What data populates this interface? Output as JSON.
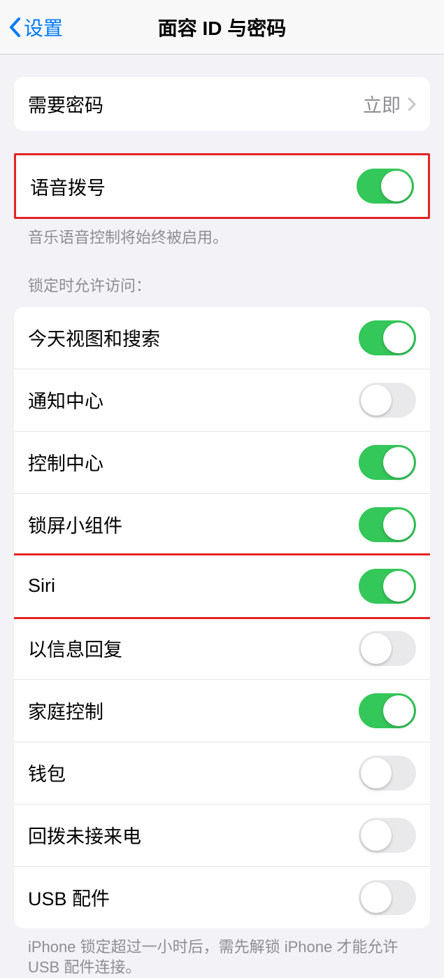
{
  "header": {
    "back_label": "设置",
    "title": "面容 ID 与密码"
  },
  "passcode_section": {
    "require_passcode_label": "需要密码",
    "require_passcode_value": "立即"
  },
  "voice_dial": {
    "label": "语音拨号",
    "on": true,
    "footer": "音乐语音控制将始终被启用。"
  },
  "lock_section": {
    "header": "锁定时允许访问：",
    "items": [
      {
        "label": "今天视图和搜索",
        "on": true,
        "highlighted": false
      },
      {
        "label": "通知中心",
        "on": false,
        "highlighted": false
      },
      {
        "label": "控制中心",
        "on": true,
        "highlighted": false
      },
      {
        "label": "锁屏小组件",
        "on": true,
        "highlighted": false
      },
      {
        "label": "Siri",
        "on": true,
        "highlighted": true
      },
      {
        "label": "以信息回复",
        "on": false,
        "highlighted": false
      },
      {
        "label": "家庭控制",
        "on": true,
        "highlighted": false
      },
      {
        "label": "钱包",
        "on": false,
        "highlighted": false
      },
      {
        "label": "回拨未接来电",
        "on": false,
        "highlighted": false
      },
      {
        "label": "USB 配件",
        "on": false,
        "highlighted": false
      }
    ],
    "footer": "iPhone 锁定超过一小时后，需先解锁 iPhone 才能允许USB 配件连接。"
  }
}
